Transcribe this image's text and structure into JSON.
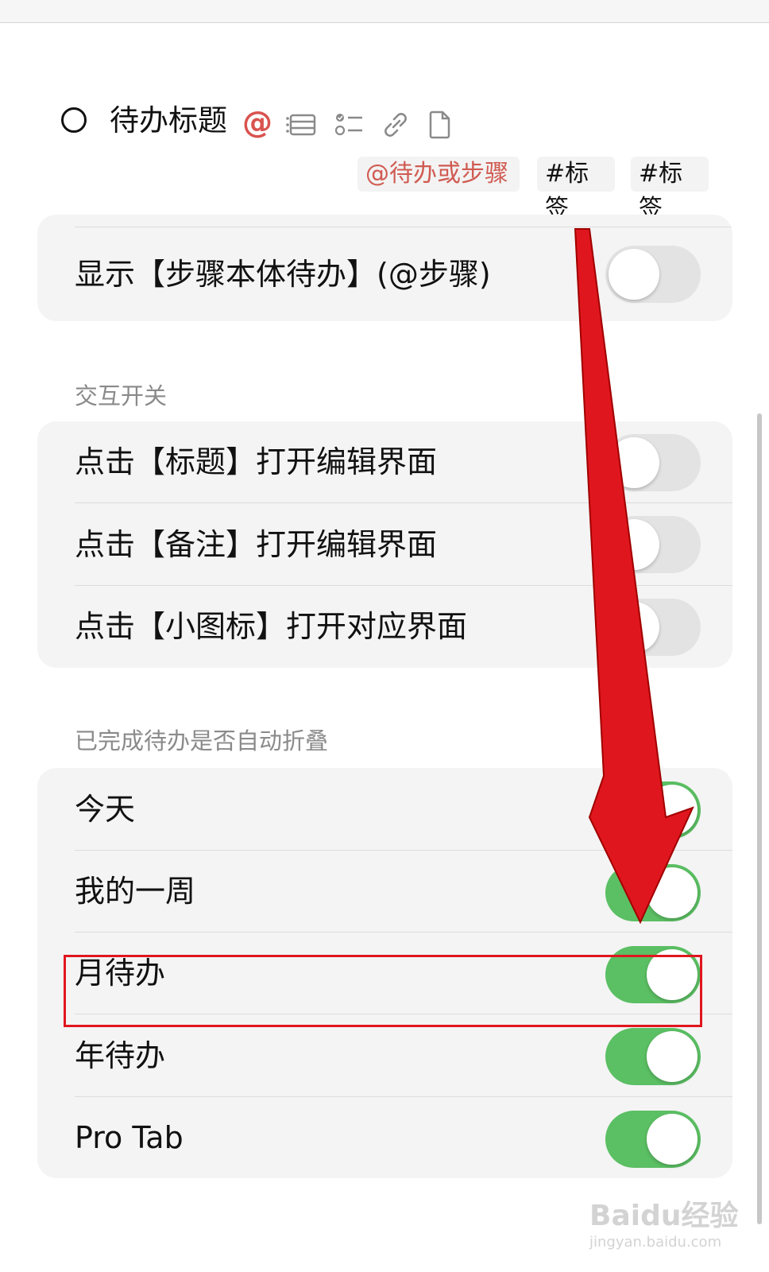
{
  "preview": {
    "todo_title": "待办标题",
    "at_symbol": "@",
    "icons": [
      "at-icon",
      "list-icon",
      "checklist-icon",
      "link-icon",
      "document-icon"
    ],
    "tags": [
      "@待办或步骤",
      "#标签",
      "#标签"
    ],
    "accent_color": "#d05b52"
  },
  "top_group": {
    "rows": [
      {
        "label": "显示【步骤本体待办】(@步骤)",
        "on": false
      }
    ]
  },
  "interaction": {
    "header": "交互开关",
    "rows": [
      {
        "label": "点击【标题】打开编辑界面",
        "on": false
      },
      {
        "label": "点击【备注】打开编辑界面",
        "on": false
      },
      {
        "label": "点击【小图标】打开对应界面",
        "on": false
      }
    ]
  },
  "fold": {
    "header": "已完成待办是否自动折叠",
    "rows": [
      {
        "label": "今天",
        "on": true
      },
      {
        "label": "我的一周",
        "on": true
      },
      {
        "label": "月待办",
        "on": true
      },
      {
        "label": "年待办",
        "on": true
      },
      {
        "label": "Pro Tab",
        "on": true
      }
    ]
  },
  "colors": {
    "toggle_on": "#5bbf63",
    "toggle_off": "#e3e3e3",
    "annotation_red": "#e0161e"
  },
  "watermark": {
    "line1": "Baidu经验",
    "line2": "jingyan.baidu.com"
  }
}
